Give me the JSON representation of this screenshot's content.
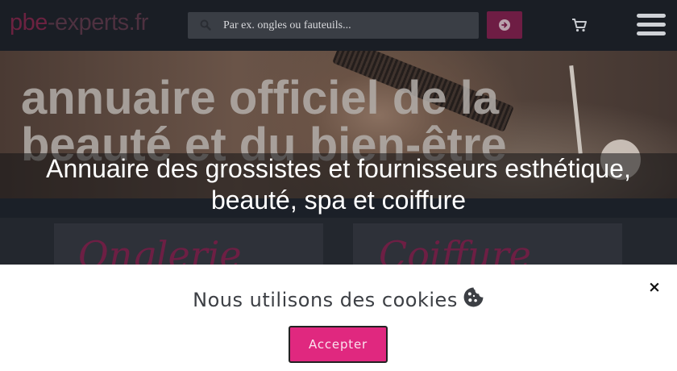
{
  "header": {
    "logo_part1": "pbe",
    "logo_part2": "-experts.fr",
    "search_placeholder": "Par ex. ongles ou fauteuils...",
    "search_icon": "magnifier-icon",
    "submit_icon": "arrow-circle-right-icon",
    "cart_icon": "shopping-cart-icon",
    "menu_icon": "hamburger-menu-icon"
  },
  "hero": {
    "background_title": "annuaire officiel de la beauté et du bien-être",
    "subtitle": "Annuaire des grossistes et fournisseurs esthétique, beauté, spa et coiffure"
  },
  "cards": [
    {
      "title": "Onglerie"
    },
    {
      "title": "Coiffure"
    }
  ],
  "cookie_banner": {
    "title": "Nous utilisons des cookies",
    "accept_label": "Accepter",
    "close_label": "×"
  },
  "colors": {
    "accent": "#e0287f",
    "header_bg": "#1a1e25",
    "text_dark": "#3c3f44"
  }
}
